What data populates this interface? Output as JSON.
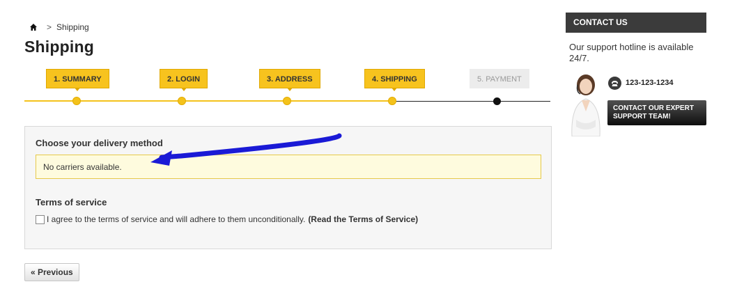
{
  "breadcrumb": {
    "separator": ">",
    "current": "Shipping"
  },
  "page": {
    "title": "Shipping"
  },
  "steps": [
    {
      "label": "1. SUMMARY",
      "state": "done"
    },
    {
      "label": "2. LOGIN",
      "state": "done"
    },
    {
      "label": "3. ADDRESS",
      "state": "done"
    },
    {
      "label": "4. SHIPPING",
      "state": "current"
    },
    {
      "label": "5. PAYMENT",
      "state": "todo"
    }
  ],
  "delivery": {
    "title": "Choose your delivery method",
    "warning": "No carriers available."
  },
  "terms": {
    "title": "Terms of service",
    "agree_text": "I agree to the terms of service and will adhere to them unconditionally.",
    "link_text": "(Read the Terms of Service)",
    "checked": false
  },
  "nav": {
    "previous_label": "« Previous"
  },
  "contact": {
    "header": "CONTACT US",
    "hotline": "Our support hotline is available 24/7.",
    "phone": "123-123-1234",
    "button_line1": "CONTACT OUR EXPERT",
    "button_line2": "SUPPORT TEAM!"
  },
  "colors": {
    "step_accent": "#f7c31e",
    "warning_bg": "#fefbde",
    "annotation_arrow": "#1a1ad6",
    "contact_header_bg": "#3b3b3b"
  }
}
